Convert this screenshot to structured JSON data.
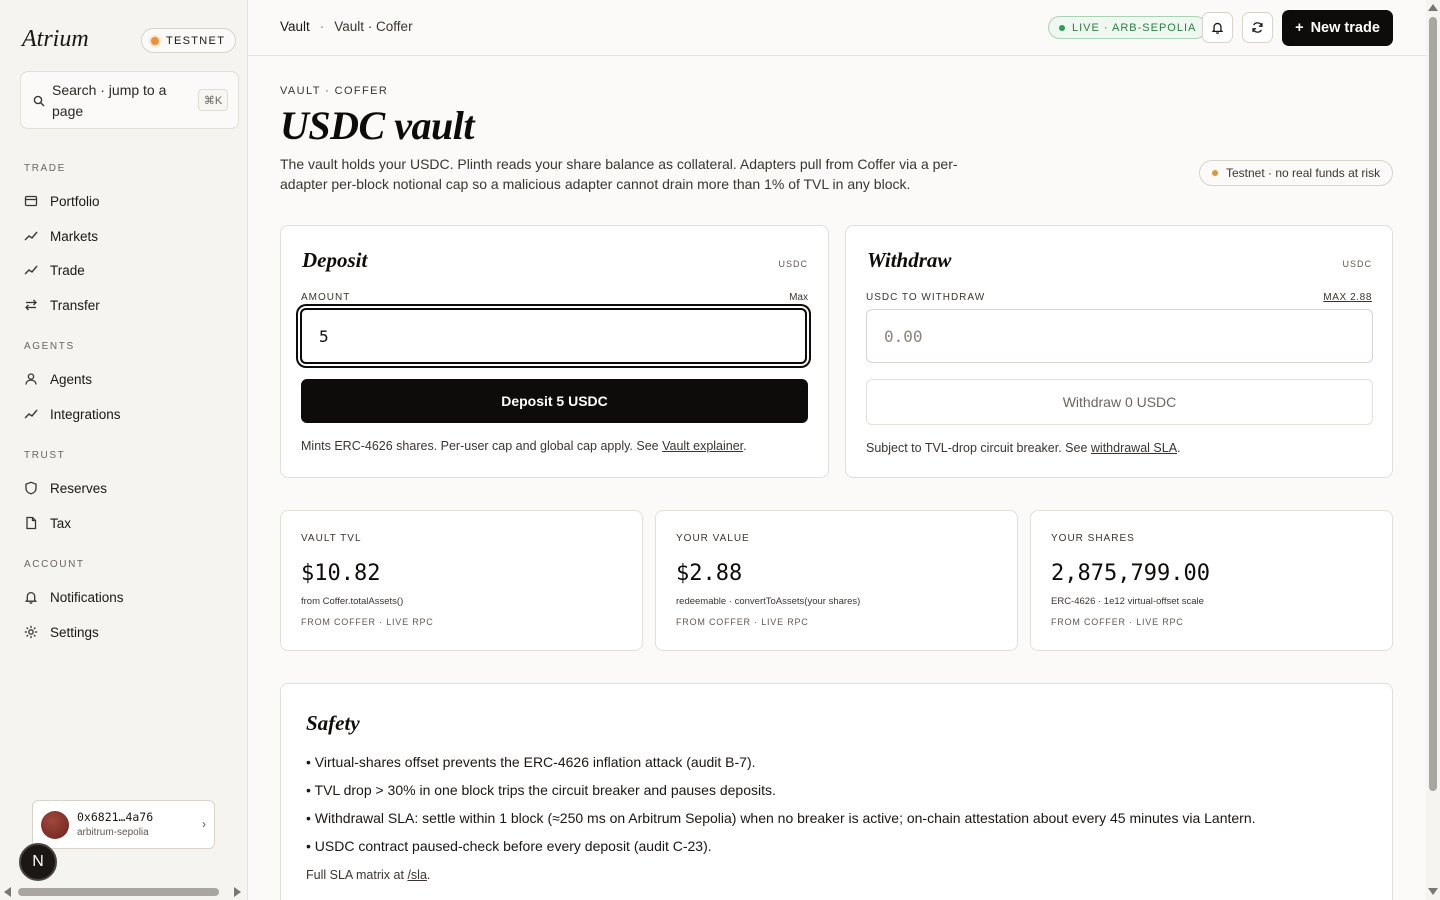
{
  "sidebar": {
    "brand": "Atrium",
    "testnet_badge": "TESTNET",
    "search": {
      "label": "Search · jump to a page",
      "shortcut": "⌘K"
    },
    "sections": [
      {
        "title": "TRADE",
        "items": [
          {
            "label": "Portfolio",
            "icon": "card-icon"
          },
          {
            "label": "Markets",
            "icon": "trend-icon"
          },
          {
            "label": "Trade",
            "icon": "trend-icon"
          },
          {
            "label": "Transfer",
            "icon": "swap-icon"
          }
        ]
      },
      {
        "title": "AGENTS",
        "items": [
          {
            "label": "Agents",
            "icon": "user-icon"
          },
          {
            "label": "Integrations",
            "icon": "trend-icon"
          }
        ]
      },
      {
        "title": "TRUST",
        "items": [
          {
            "label": "Reserves",
            "icon": "shield-icon"
          },
          {
            "label": "Tax",
            "icon": "document-icon"
          }
        ]
      },
      {
        "title": "ACCOUNT",
        "items": [
          {
            "label": "Notifications",
            "icon": "bell-icon"
          },
          {
            "label": "Settings",
            "icon": "gear-icon"
          }
        ]
      }
    ],
    "wallet": {
      "address": "0x6821…4a76",
      "network": "arbitrum-sepolia",
      "chevron": "›"
    },
    "user_badge": "N"
  },
  "topbar": {
    "breadcrumb": [
      "Vault",
      "·",
      "Vault · Coffer"
    ],
    "network_status": "LIVE · ARB-SEPOLIA",
    "new_trade": "New trade",
    "new_trade_plus": "+"
  },
  "page": {
    "eyebrow": "VAULT · COFFER",
    "title": "USDC vault",
    "intro": "The vault holds your USDC. Plinth reads your share balance as collateral. Adapters pull from Coffer via a per-adapter per-block notional cap so a malicious adapter cannot drain more than 1% of TVL in any block.",
    "risk_badge": "Testnet · no real funds at risk"
  },
  "deposit": {
    "title": "Deposit",
    "unit": "USDC",
    "field_label": "AMOUNT",
    "max_label": "Max",
    "value": "5",
    "button": "Deposit 5 USDC",
    "note_prefix": "Mints ERC-4626 shares. Per-user cap and global cap apply. See ",
    "note_link": "Vault explainer",
    "note_suffix": "."
  },
  "withdraw": {
    "title": "Withdraw",
    "unit": "USDC",
    "field_label": "USDC TO WITHDRAW",
    "max_label": "MAX 2.88",
    "placeholder": "0.00",
    "button": "Withdraw 0 USDC",
    "note_prefix": "Subject to TVL-drop circuit breaker. See ",
    "note_link": "withdrawal SLA",
    "note_suffix": "."
  },
  "stats": [
    {
      "label": "VAULT TVL",
      "value": "$10.82",
      "sub": "from Coffer.totalAssets()",
      "source": "FROM COFFER · LIVE RPC"
    },
    {
      "label": "YOUR VALUE",
      "value": "$2.88",
      "sub": "redeemable · convertToAssets(your shares)",
      "source": "FROM COFFER · LIVE RPC"
    },
    {
      "label": "YOUR SHARES",
      "value": "2,875,799.00",
      "sub": "ERC-4626 · 1e12 virtual-offset scale",
      "source": "FROM COFFER · LIVE RPC"
    }
  ],
  "safety": {
    "title": "Safety",
    "items": [
      "• Virtual-shares offset prevents the ERC-4626 inflation attack (audit B-7).",
      "• TVL drop > 30% in one block trips the circuit breaker and pauses deposits.",
      "• Withdrawal SLA: settle within 1 block (≈250 ms on Arbitrum Sepolia) when no breaker is active; on-chain attestation about every 45 minutes via Lantern.",
      "• USDC contract paused-check before every deposit (audit C-23)."
    ],
    "footer_prefix": "Full SLA matrix at ",
    "footer_link": "/sla",
    "footer_suffix": "."
  },
  "colors": {
    "accent": "#0e0c0a",
    "live_green": "#2e7d46",
    "testnet_orange": "#e8923a",
    "background": "#fbfaf8"
  }
}
